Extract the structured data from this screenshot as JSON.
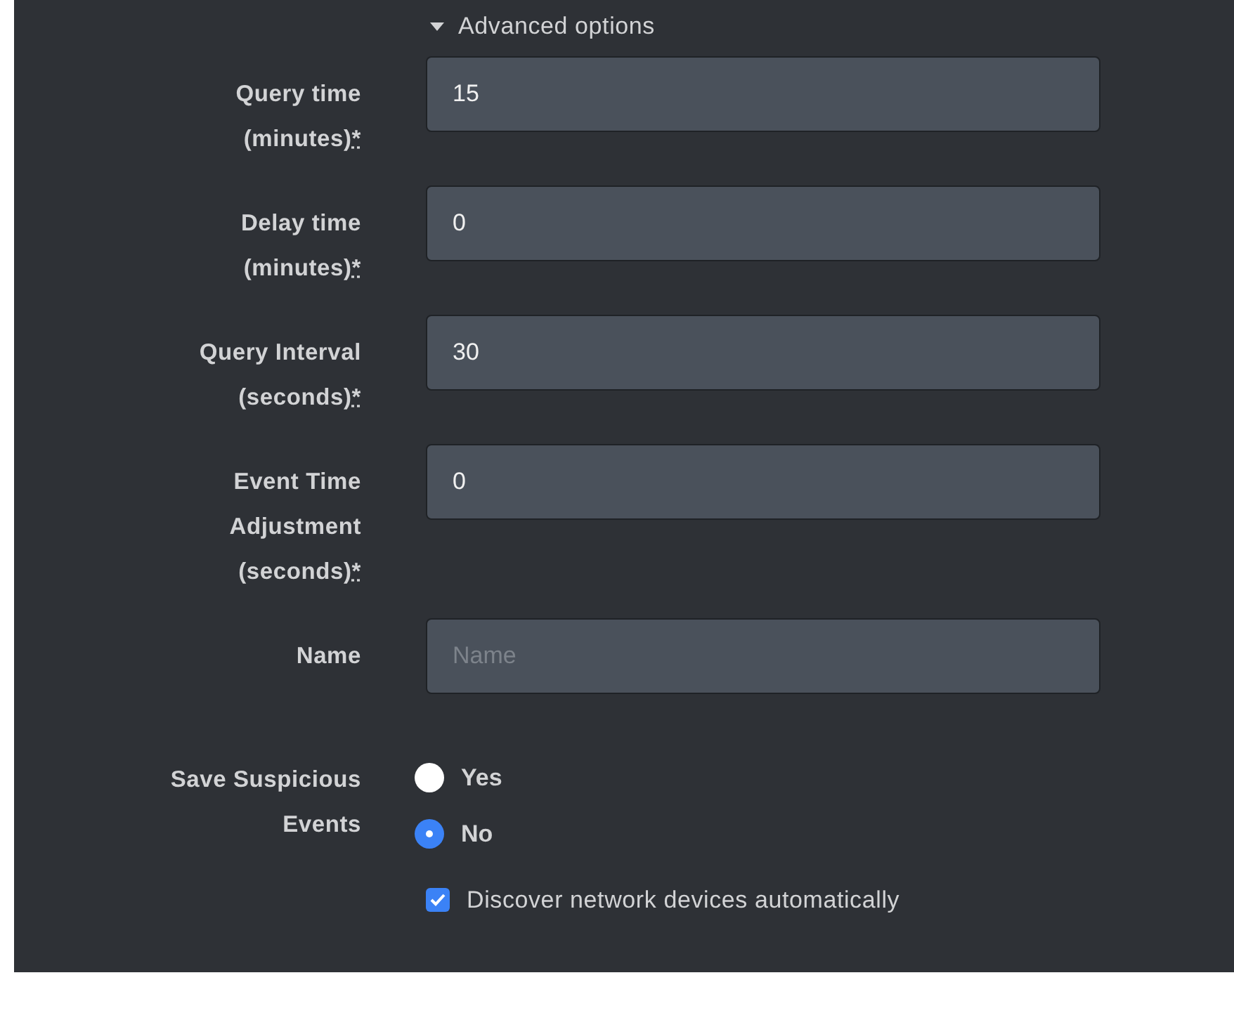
{
  "section_toggle": {
    "label": "Advanced options",
    "expanded": true
  },
  "fields": [
    {
      "label": "Query time (minutes)",
      "required_mark": "*",
      "value": "15"
    },
    {
      "label": "Delay time (minutes)",
      "required_mark": "*",
      "value": "0"
    },
    {
      "label": "Query Interval (seconds)",
      "required_mark": "*",
      "value": "30"
    },
    {
      "label": "Event Time Adjustment (seconds)",
      "required_mark": "*",
      "value": "0"
    },
    {
      "label": "Name",
      "placeholder": "Name"
    }
  ],
  "radio_group": {
    "label": "Save Suspicious Events",
    "options": [
      {
        "label": "Yes",
        "selected": false
      },
      {
        "label": "No",
        "selected": true
      }
    ]
  },
  "checkbox": {
    "label": "Discover network devices automatically",
    "checked": true
  }
}
